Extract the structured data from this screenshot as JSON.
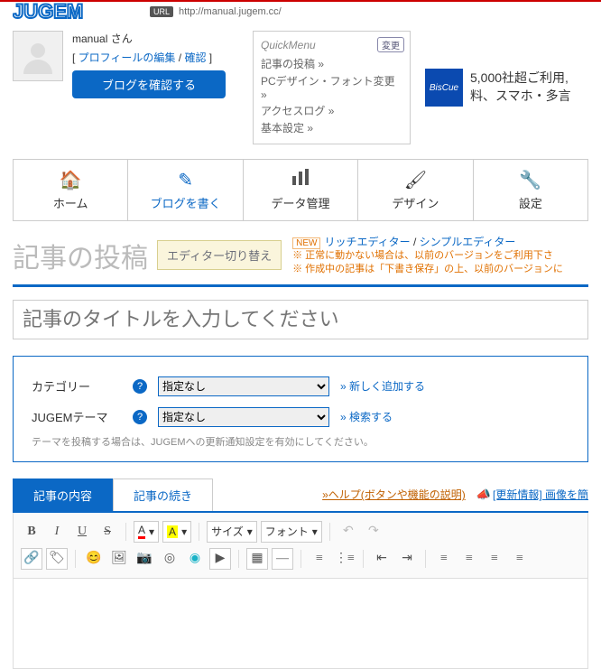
{
  "url_bar": {
    "chip": "URL",
    "url": "http://manual.jugem.cc/"
  },
  "logo": "JUGEM",
  "user": {
    "name": "manual",
    "honor": "さん",
    "profile_edit": "プロフィールの編集",
    "confirm": "確認",
    "blog_check": "ブログを確認する"
  },
  "quickmenu": {
    "title": "QuickMenu",
    "change": "変更",
    "items": [
      "記事の投稿 »",
      "PCデザイン・フォント変更 »",
      "アクセスログ »",
      "基本設定 »"
    ]
  },
  "ad": {
    "img": "BisCue",
    "line1": "5,000社超ご利用,",
    "line2": "料、スマホ・多言"
  },
  "nav": {
    "home": "ホーム",
    "write": "ブログを書く",
    "data": "データ管理",
    "design": "デザイン",
    "settings": "設定"
  },
  "page": {
    "title": "記事の投稿",
    "switch": "エディター切り替え",
    "rich": "リッチエディター",
    "simple": "シンプルエディター",
    "new": "NEW",
    "sep": " / ",
    "warn1": "※ 正常に動かない場合は、以前のバージョンをご利用下さ",
    "warn2": "※ 作成中の記事は「下書き保存」の上、以前のバージョンに"
  },
  "title_input": {
    "placeholder": "記事のタイトルを入力してください"
  },
  "meta": {
    "category_label": "カテゴリー",
    "category_value": "指定なし",
    "category_new": "» 新しく追加する",
    "theme_label": "JUGEMテーマ",
    "theme_value": "指定なし",
    "theme_search": "» 検索する",
    "theme_note": "テーマを投稿する場合は、JUGEMへの更新通知設定を有効にしてください。"
  },
  "tabs": {
    "content": "記事の内容",
    "continued": "記事の続き",
    "help": "»ヘルプ(ボタンや機能の説明)",
    "update": "[更新情報] 画像を簡"
  },
  "toolbar": {
    "size": "サイズ",
    "font": "フォント",
    "A": "A"
  }
}
